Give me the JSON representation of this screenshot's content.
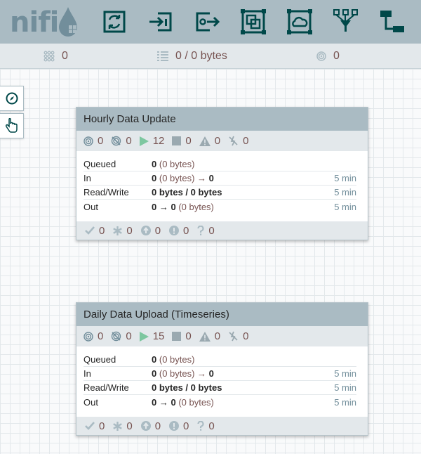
{
  "app": {
    "logo": "nifi"
  },
  "toolbar": {
    "items": [
      {
        "name": "processor-tool"
      },
      {
        "name": "input-port-tool"
      },
      {
        "name": "output-port-tool"
      },
      {
        "name": "process-group-tool"
      },
      {
        "name": "remote-process-group-tool"
      },
      {
        "name": "funnel-tool"
      },
      {
        "name": "template-tool"
      }
    ]
  },
  "status": {
    "active_threads": "0",
    "queued": "0 / 0 bytes",
    "remote_transmitting": "0"
  },
  "process_groups": [
    {
      "title": "Hourly Data Update",
      "counts": {
        "transmitting": "0",
        "not_transmitting": "0",
        "running": "12",
        "stopped": "0",
        "invalid": "0",
        "disabled": "0"
      },
      "stats": {
        "queued_label": "Queued",
        "queued_count": "0",
        "queued_size": "(0 bytes)",
        "in_label": "In",
        "in_count": "0",
        "in_size": "(0 bytes) →",
        "in_dest": "0",
        "in_time": "5 min",
        "rw_label": "Read/Write",
        "rw_value": "0 bytes / 0 bytes",
        "rw_time": "5 min",
        "out_label": "Out",
        "out_count": "0 → 0",
        "out_size": "(0 bytes)",
        "out_time": "5 min"
      },
      "footer": {
        "up_to_date": "0",
        "locally_modified": "0",
        "stale": "0",
        "modified_stale": "0",
        "sync_failure": "0"
      }
    },
    {
      "title": "Daily Data Upload (Timeseries)",
      "counts": {
        "transmitting": "0",
        "not_transmitting": "0",
        "running": "15",
        "stopped": "0",
        "invalid": "0",
        "disabled": "0"
      },
      "stats": {
        "queued_label": "Queued",
        "queued_count": "0",
        "queued_size": "(0 bytes)",
        "in_label": "In",
        "in_count": "0",
        "in_size": "(0 bytes) →",
        "in_dest": "0",
        "in_time": "5 min",
        "rw_label": "Read/Write",
        "rw_value": "0 bytes / 0 bytes",
        "rw_time": "5 min",
        "out_label": "Out",
        "out_count": "0 → 0",
        "out_size": "(0 bytes)",
        "out_time": "5 min"
      },
      "footer": {
        "up_to_date": "0",
        "locally_modified": "0",
        "stale": "0",
        "modified_stale": "0",
        "sync_failure": "0"
      }
    }
  ],
  "palette": {
    "navigate": "compass-icon",
    "operate": "hand-pointer-icon"
  },
  "colors": {
    "header": "#aabbc3",
    "accent": "#004849",
    "running": "#7dc7a0",
    "value": "#775351"
  }
}
